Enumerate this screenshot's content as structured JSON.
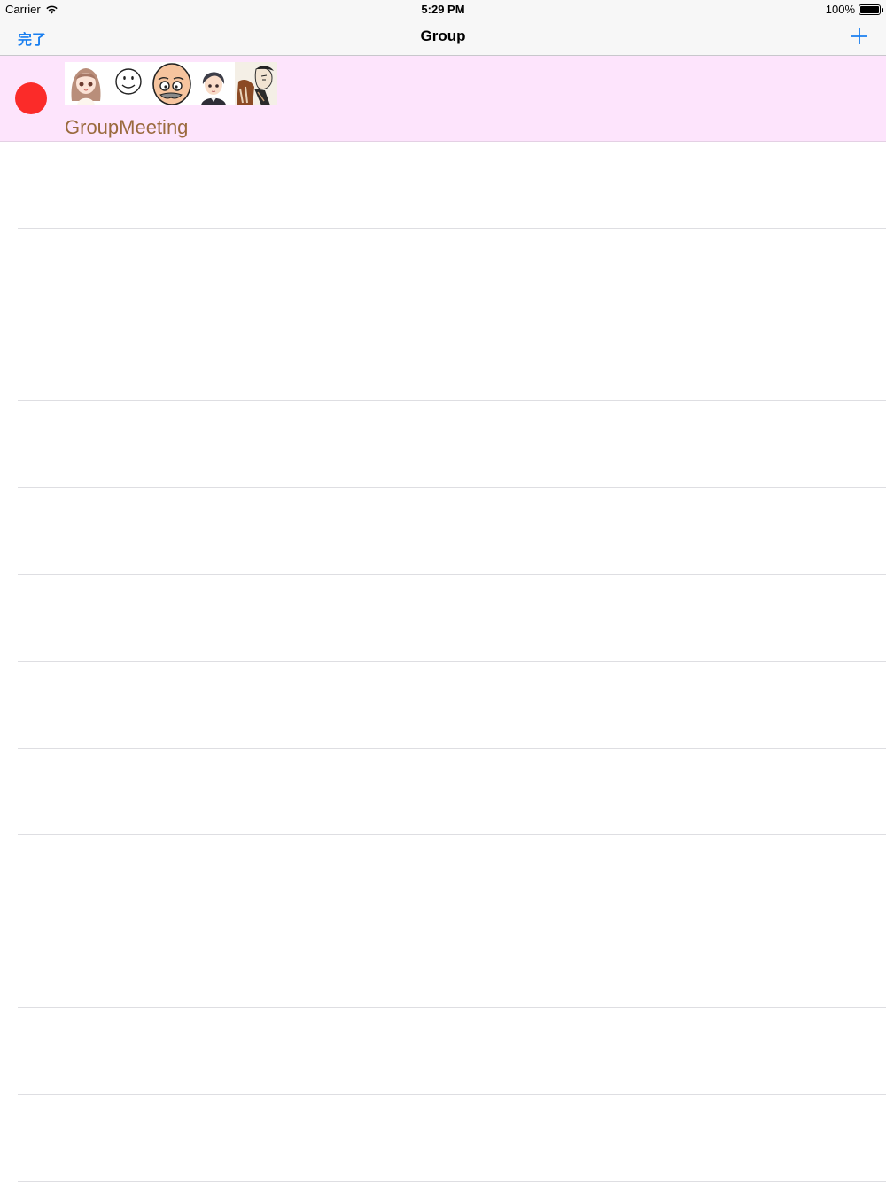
{
  "status_bar": {
    "carrier": "Carrier",
    "time": "5:29 PM",
    "battery_text": "100%",
    "battery_level": 1.0
  },
  "nav": {
    "done_label": "完了",
    "title": "Group",
    "add_icon": "plus-icon",
    "accent_color": "#1a7ff0"
  },
  "groups": [
    {
      "name": "GroupMeeting",
      "status_color": "#fb2b29",
      "row_color": "#fde4fc",
      "avatars": [
        "girl-avatar",
        "smiley-avatar",
        "bald-man-avatar",
        "boy-avatar",
        "ukiyoe-avatar"
      ]
    }
  ],
  "empty_rows": 12
}
